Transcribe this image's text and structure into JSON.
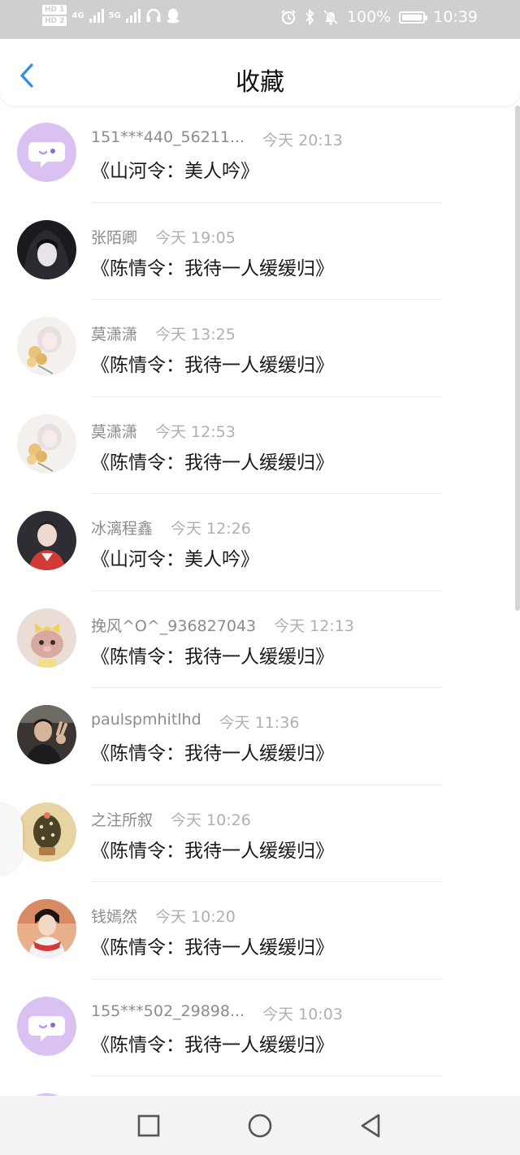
{
  "status_bar": {
    "sim1": "HD 1",
    "sim2": "HD 2",
    "net1": "4G",
    "net2": "5G",
    "battery_percent": "100%",
    "time": "10:39",
    "icons": [
      "alarm-icon",
      "bluetooth-icon",
      "mute-bell-icon",
      "battery-charging-icon",
      "headphones-icon",
      "qq-penguin-icon"
    ]
  },
  "header": {
    "title": "收藏",
    "back_icon": "chevron-left-icon",
    "accent_color": "#2f8fe8"
  },
  "items": [
    {
      "name": "151***440_56211...",
      "time": "今天 20:13",
      "content": "《山河令：美人吟》",
      "avatar": "default-chat-bubble"
    },
    {
      "name": "张陌卿",
      "time": "今天 19:05",
      "content": "《陈情令：我待一人缓缓归》",
      "avatar": "dark-hooded-character"
    },
    {
      "name": "莫潇潇",
      "time": "今天 13:25",
      "content": "《陈情令：我待一人缓缓归》",
      "avatar": "anime-girl-flowers"
    },
    {
      "name": "莫潇潇",
      "time": "今天 12:53",
      "content": "《陈情令：我待一人缓缓归》",
      "avatar": "anime-girl-flowers"
    },
    {
      "name": "冰漓程鑫",
      "time": "今天 12:26",
      "content": "《山河令：美人吟》",
      "avatar": "boy-red-jacket"
    },
    {
      "name": "挽风^O^_936827043",
      "time": "今天 12:13",
      "content": "《陈情令：我待一人缓缓归》",
      "avatar": "plush-doll"
    },
    {
      "name": "paulspmhitlhd",
      "time": "今天 11:36",
      "content": "《陈情令：我待一人缓缓归》",
      "avatar": "person-peace-sign"
    },
    {
      "name": "之注所叙",
      "time": "今天 10:26",
      "content": "《陈情令：我待一人缓缓归》",
      "avatar": "cactus-illustration"
    },
    {
      "name": "钱嫣然",
      "time": "今天 10:20",
      "content": "《陈情令：我待一人缓缓归》",
      "avatar": "woman-red-scarf"
    },
    {
      "name": "155***502_29898...",
      "time": "今天 10:03",
      "content": "《陈情令：我待一人缓缓归》",
      "avatar": "default-chat-bubble"
    }
  ],
  "nav_bar": {
    "recent_icon": "square-icon",
    "home_icon": "circle-icon",
    "back_icon": "triangle-back-icon"
  }
}
